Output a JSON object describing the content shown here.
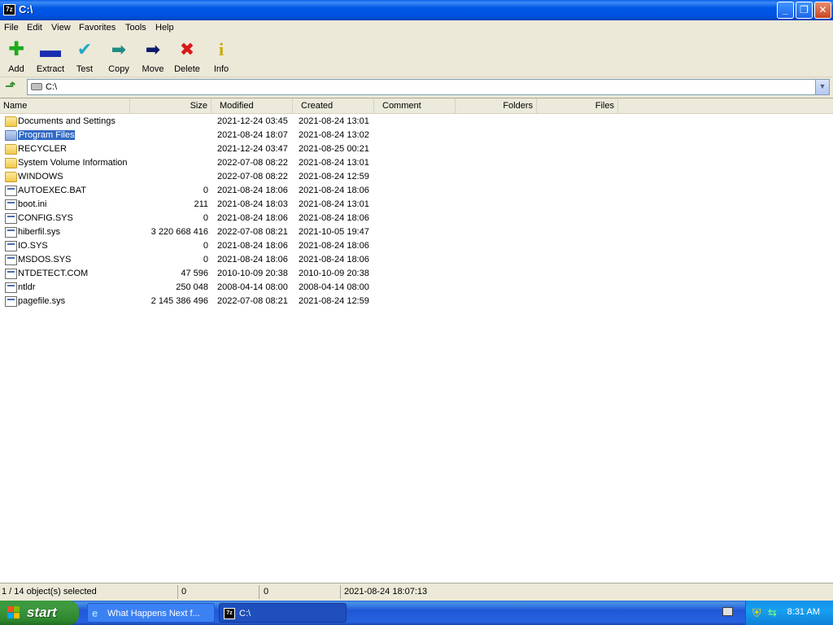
{
  "window": {
    "title": "C:\\",
    "app_icon_text": "7z",
    "controls": [
      "minimize",
      "maximize",
      "close"
    ]
  },
  "menu": [
    "File",
    "Edit",
    "View",
    "Favorites",
    "Tools",
    "Help"
  ],
  "toolbar": [
    {
      "label": "Add",
      "icon": "plus-icon",
      "color": "#1DAA1D"
    },
    {
      "label": "Extract",
      "icon": "minus-icon",
      "color": "#1A2DB0"
    },
    {
      "label": "Test",
      "icon": "check-icon",
      "color": "#20A8C8"
    },
    {
      "label": "Copy",
      "icon": "right-arrow-icon",
      "color": "#1F8C84"
    },
    {
      "label": "Move",
      "icon": "right-arrow-icon",
      "color": "#101A6A"
    },
    {
      "label": "Delete",
      "icon": "x-icon",
      "color": "#D81818"
    },
    {
      "label": "Info",
      "icon": "info-icon",
      "color": "#C8A800"
    }
  ],
  "address": {
    "path": "C:\\"
  },
  "columns": [
    "Name",
    "Size",
    "Modified",
    "Created",
    "Comment",
    "Folders",
    "Files"
  ],
  "files": [
    {
      "name": "Documents and Settings",
      "size": "",
      "modified": "2021-12-24 03:45",
      "created": "2021-08-24 13:01",
      "type": "folder"
    },
    {
      "name": "Program Files",
      "size": "",
      "modified": "2021-08-24 18:07",
      "created": "2021-08-24 13:02",
      "type": "folder",
      "selected": true
    },
    {
      "name": "RECYCLER",
      "size": "",
      "modified": "2021-12-24 03:47",
      "created": "2021-08-25 00:21",
      "type": "folder"
    },
    {
      "name": "System Volume Information",
      "size": "",
      "modified": "2022-07-08 08:22",
      "created": "2021-08-24 13:01",
      "type": "folder"
    },
    {
      "name": "WINDOWS",
      "size": "",
      "modified": "2022-07-08 08:22",
      "created": "2021-08-24 12:59",
      "type": "folder"
    },
    {
      "name": "AUTOEXEC.BAT",
      "size": "0",
      "modified": "2021-08-24 18:06",
      "created": "2021-08-24 18:06",
      "type": "file"
    },
    {
      "name": "boot.ini",
      "size": "211",
      "modified": "2021-08-24 18:03",
      "created": "2021-08-24 13:01",
      "type": "file"
    },
    {
      "name": "CONFIG.SYS",
      "size": "0",
      "modified": "2021-08-24 18:06",
      "created": "2021-08-24 18:06",
      "type": "file"
    },
    {
      "name": "hiberfil.sys",
      "size": "3 220 668 416",
      "modified": "2022-07-08 08:21",
      "created": "2021-10-05 19:47",
      "type": "file"
    },
    {
      "name": "IO.SYS",
      "size": "0",
      "modified": "2021-08-24 18:06",
      "created": "2021-08-24 18:06",
      "type": "file"
    },
    {
      "name": "MSDOS.SYS",
      "size": "0",
      "modified": "2021-08-24 18:06",
      "created": "2021-08-24 18:06",
      "type": "file"
    },
    {
      "name": "NTDETECT.COM",
      "size": "47 596",
      "modified": "2010-10-09 20:38",
      "created": "2010-10-09 20:38",
      "type": "file"
    },
    {
      "name": "ntldr",
      "size": "250 048",
      "modified": "2008-04-14 08:00",
      "created": "2008-04-14 08:00",
      "type": "file"
    },
    {
      "name": "pagefile.sys",
      "size": "2 145 386 496",
      "modified": "2022-07-08 08:21",
      "created": "2021-08-24 12:59",
      "type": "file"
    }
  ],
  "status": {
    "selection": "1 / 14 object(s) selected",
    "size": "0",
    "packed": "0",
    "modified": "2021-08-24 18:07:13"
  },
  "taskbar": {
    "start_label": "start",
    "tasks": [
      {
        "label": "What Happens Next f...",
        "icon": "ie-icon"
      },
      {
        "label": "C:\\",
        "icon": "7zip-icon"
      }
    ],
    "clock": "8:31 AM"
  }
}
